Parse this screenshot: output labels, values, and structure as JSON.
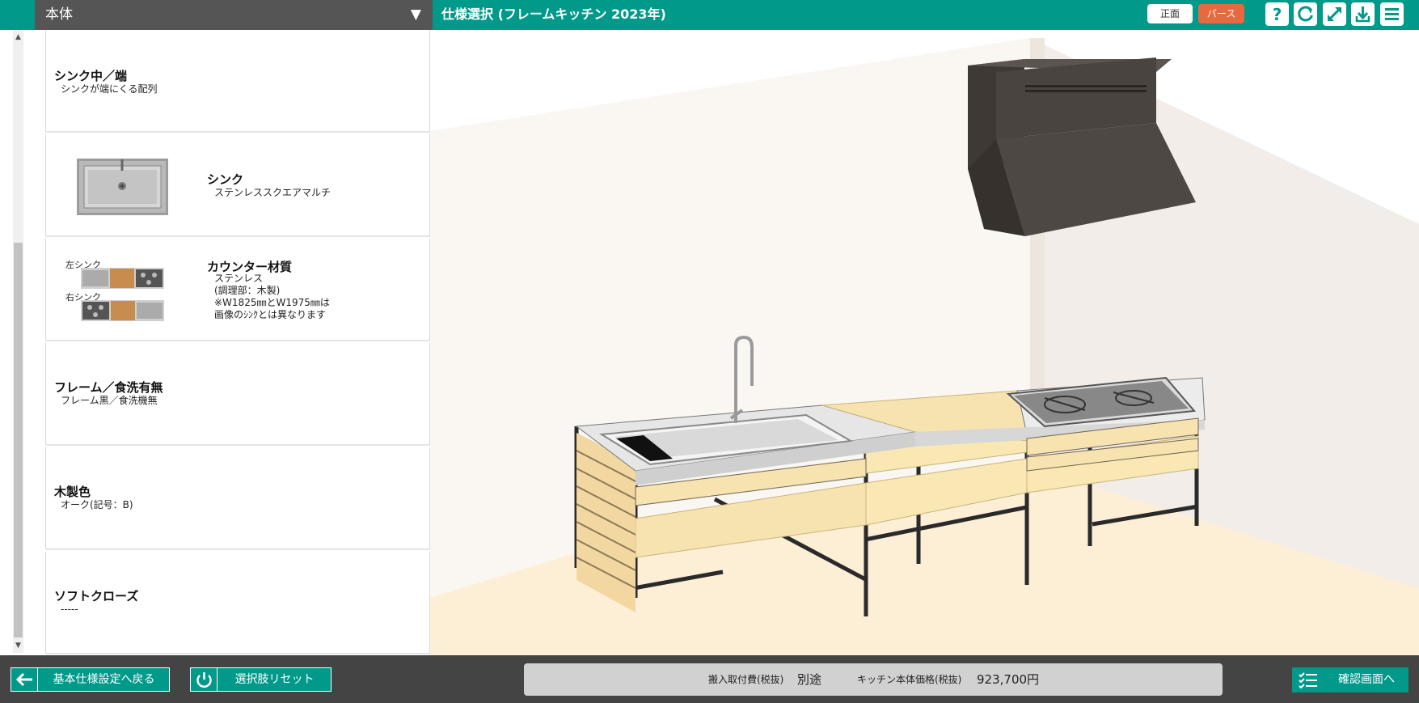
{
  "panel": {
    "header_label": "本体",
    "dropdown_icon": "triangle-down-icon"
  },
  "app": {
    "title": "仕様選択 (フレームキッチン 2023年)",
    "view_front_label": "正面",
    "view_perspective_label": "パース",
    "tools": [
      "help-icon",
      "rotate-icon",
      "expand-icon",
      "download-icon",
      "menu-icon"
    ]
  },
  "options": [
    {
      "title": "シンク中／端",
      "value": "シンクが端にくる配列"
    },
    {
      "title": "シンク",
      "value": "ステンレススクエアマルチ"
    },
    {
      "title": "カウンター材質",
      "value": "ステンレス\n(調理部：木製)\n※W1825㎜とW1975㎜は\n画像のｼﾝｸとは異なります",
      "thumb_labels": [
        "左シンク",
        "右シンク"
      ]
    },
    {
      "title": "フレーム／食洗有無",
      "value": "フレーム黒／食洗機無"
    },
    {
      "title": "木製色",
      "value": "オーク(記号：B)"
    },
    {
      "title": "ソフトクローズ",
      "value": "-----"
    }
  ],
  "footer": {
    "back_label": "基本仕様設定へ戻る",
    "reset_label": "選択肢リセット",
    "install_fee_label": "搬入取付費(税抜)",
    "install_fee_value": "別途",
    "price_label": "キッチン本体価格(税抜)",
    "price_value": "923,700円",
    "confirm_label": "確認画面へ"
  },
  "colors": {
    "brand": "#00998a",
    "accent_orange": "#e8693d",
    "panel_header": "#555555",
    "bottom_bar": "#444444",
    "wood": "#f7e3b0",
    "hood": "#4a4440",
    "floor": "#fdefd6"
  }
}
